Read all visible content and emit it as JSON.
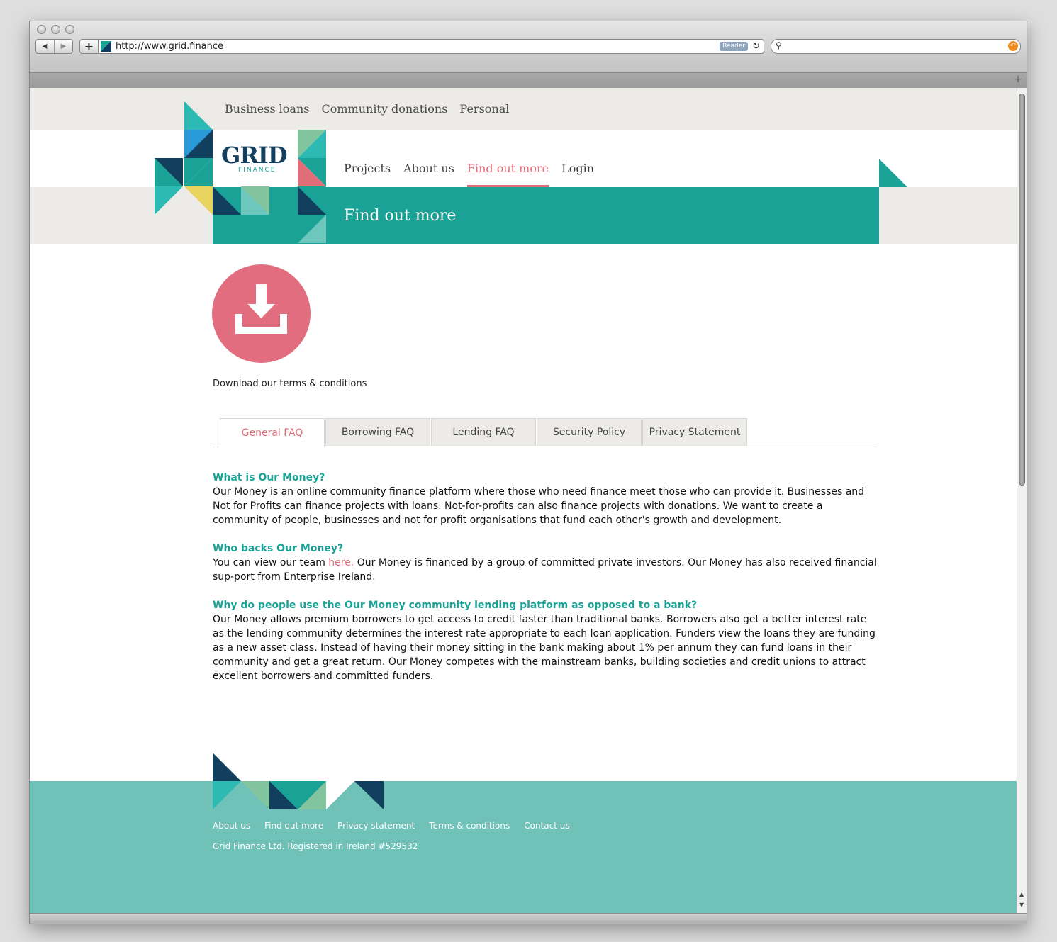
{
  "browser": {
    "url": "http://www.grid.finance",
    "reader_label": "Reader"
  },
  "top_nav": [
    "Business loans",
    "Community donations",
    "Personal"
  ],
  "logo": {
    "name": "GRID",
    "subtitle": "FINANCE"
  },
  "main_nav": [
    {
      "label": "Projects",
      "active": false
    },
    {
      "label": "About us",
      "active": false
    },
    {
      "label": "Find out more",
      "active": true
    },
    {
      "label": "Login",
      "active": false
    }
  ],
  "banner": {
    "title": "Find out more"
  },
  "download": {
    "label": "Download our terms & conditions",
    "icon": "download-icon"
  },
  "tabs": [
    {
      "label": "General FAQ",
      "active": true
    },
    {
      "label": "Borrowing FAQ",
      "active": false
    },
    {
      "label": "Lending FAQ",
      "active": false
    },
    {
      "label": "Security Policy",
      "active": false
    },
    {
      "label": "Privacy Statement",
      "active": false
    }
  ],
  "faq": [
    {
      "question": "What is Our Money?",
      "answer": "Our Money is an online community finance platform where those who need finance meet those who can provide it. Businesses and Not for Profits can finance projects with loans. Not-for-profits can also finance projects with donations. We want to create a community of people, businesses and not for profit organisations that fund each other's growth and development."
    },
    {
      "question": "Who backs Our Money?",
      "answer_before": "You can view our team ",
      "answer_link": "here.",
      "answer_after": " Our Money is financed by a group of committed private investors. Our Money has also received financial sup-port from Enterprise Ireland."
    },
    {
      "question": "Why do people use the Our Money community lending platform as opposed to a bank?",
      "answer": "Our Money allows premium borrowers to get access to credit faster than traditional banks. Borrowers also get a better interest rate as the lending community determines the interest rate appropriate to each loan application. Funders view the loans they are funding as a new asset class. Instead of having their money sitting in the bank making about 1% per annum they can fund loans in their community and get a great return. Our Money competes with the mainstream banks, building societies and credit unions to attract excellent borrowers and committed funders."
    }
  ],
  "footer": {
    "links": [
      "About us",
      "Find out more",
      "Privacy statement",
      "Terms & conditions",
      "Contact us"
    ],
    "legal": "Grid Finance Ltd. Registered in Ireland #529532"
  },
  "colors": {
    "teal": "#1aa296",
    "navy": "#133f5e",
    "pink": "#e16d79",
    "footer_teal": "#70c2b8",
    "light_band": "#ecebe7"
  }
}
